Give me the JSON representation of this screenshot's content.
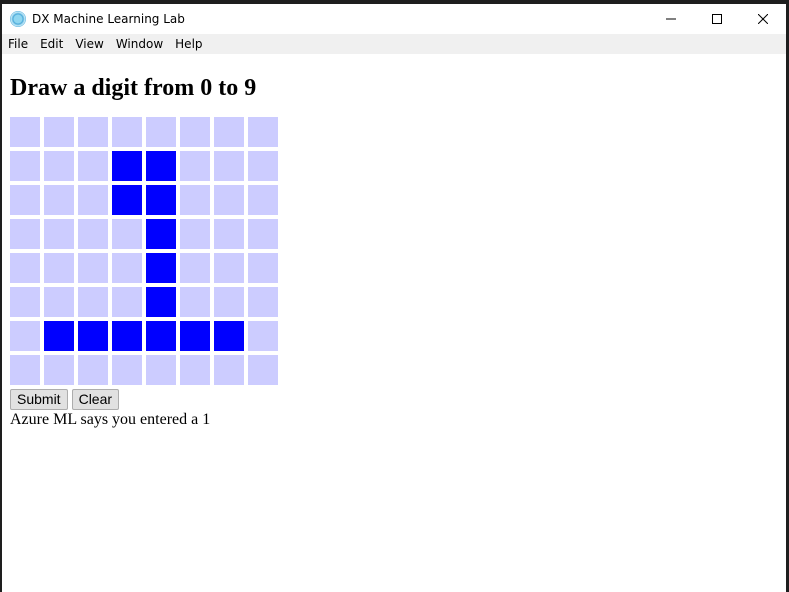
{
  "window": {
    "title": "DX Machine Learning Lab",
    "controls": [
      "minimize",
      "maximize",
      "close"
    ]
  },
  "menu": [
    "File",
    "Edit",
    "View",
    "Window",
    "Help"
  ],
  "heading": "Draw a digit from 0 to 9",
  "grid": {
    "rows": 8,
    "cols": 8,
    "cells": [
      [
        0,
        0,
        0,
        0,
        0,
        0,
        0,
        0
      ],
      [
        0,
        0,
        0,
        1,
        1,
        0,
        0,
        0
      ],
      [
        0,
        0,
        0,
        1,
        1,
        0,
        0,
        0
      ],
      [
        0,
        0,
        0,
        0,
        1,
        0,
        0,
        0
      ],
      [
        0,
        0,
        0,
        0,
        1,
        0,
        0,
        0
      ],
      [
        0,
        0,
        0,
        0,
        1,
        0,
        0,
        0
      ],
      [
        0,
        1,
        1,
        1,
        1,
        1,
        1,
        0
      ],
      [
        0,
        0,
        0,
        0,
        0,
        0,
        0,
        0
      ]
    ],
    "on_color": "#0000ff",
    "off_color": "#ccccff"
  },
  "buttons": {
    "submit": "Submit",
    "clear": "Clear"
  },
  "result": "Azure ML says you entered a 1"
}
